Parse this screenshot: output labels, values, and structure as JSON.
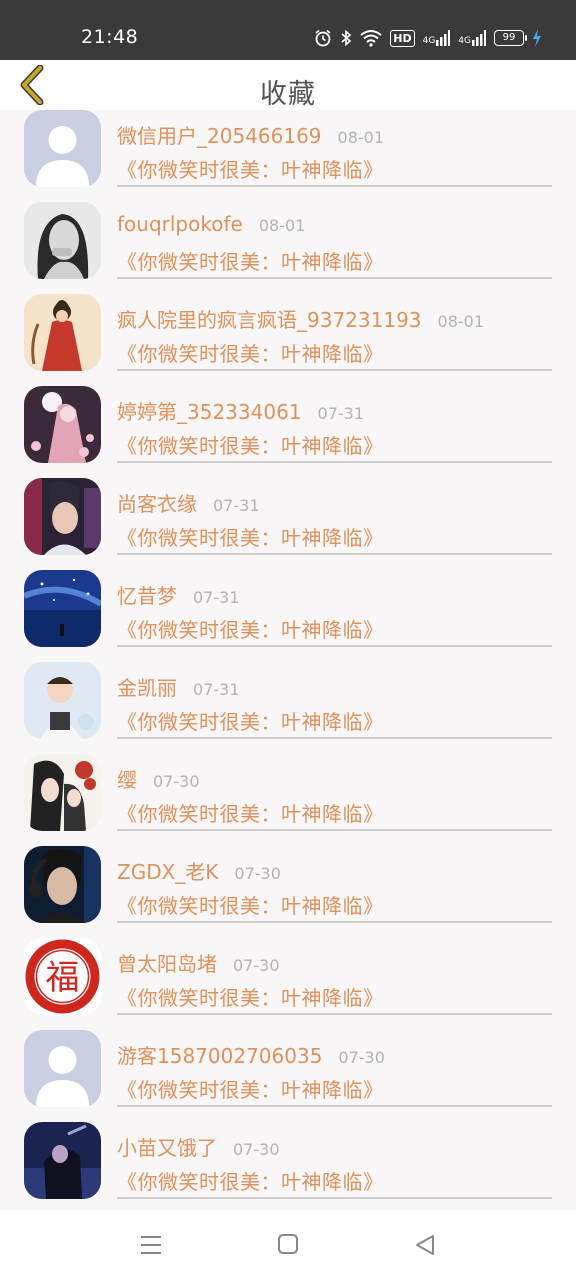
{
  "status_bar": {
    "time": "21:48",
    "hd": "HD",
    "net1": "4G",
    "net2": "4G",
    "battery": "99",
    "colors": {
      "background": "#3a3a3a",
      "charging": "#3fa9f5"
    }
  },
  "header": {
    "title": "收藏",
    "back_icon": "chevron-left-icon",
    "back_color": "#b59317"
  },
  "colors": {
    "accent": "#e0925a",
    "date": "#b3b3b3"
  },
  "items": [
    {
      "name": "微信用户_205466169",
      "date": "08-01",
      "book": "《你微笑时很美：叶神降临》",
      "avatar": "default-avatar"
    },
    {
      "name": "fouqrlpokofe",
      "date": "08-01",
      "book": "《你微笑时很美：叶神降临》",
      "avatar": "photo-avatar"
    },
    {
      "name": "疯人院里的疯言疯语_937231193",
      "date": "08-01",
      "book": "《你微笑时很美：叶神降临》",
      "avatar": "photo-avatar"
    },
    {
      "name": "婷婷第_352334061",
      "date": "07-31",
      "book": "《你微笑时很美：叶神降临》",
      "avatar": "photo-avatar"
    },
    {
      "name": "尚客衣缘",
      "date": "07-31",
      "book": "《你微笑时很美：叶神降临》",
      "avatar": "photo-avatar"
    },
    {
      "name": "忆昔梦",
      "date": "07-31",
      "book": "《你微笑时很美：叶神降临》",
      "avatar": "photo-avatar"
    },
    {
      "name": "金凯丽",
      "date": "07-31",
      "book": "《你微笑时很美：叶神降临》",
      "avatar": "photo-avatar"
    },
    {
      "name": "缨",
      "date": "07-30",
      "book": "《你微笑时很美：叶神降临》",
      "avatar": "photo-avatar"
    },
    {
      "name": "ZGDX_老K",
      "date": "07-30",
      "book": "《你微笑时很美：叶神降临》",
      "avatar": "photo-avatar"
    },
    {
      "name": "曾太阳岛堵",
      "date": "07-30",
      "book": "《你微笑时很美：叶神降临》",
      "avatar": "fu-avatar"
    },
    {
      "name": "游客1587002706035",
      "date": "07-30",
      "book": "《你微笑时很美：叶神降临》",
      "avatar": "default-avatar"
    },
    {
      "name": "小苗又饿了",
      "date": "07-30",
      "book": "《你微笑时很美：叶神降临》",
      "avatar": "photo-avatar"
    }
  ],
  "nav": {
    "menu_icon": "menu-icon",
    "home_icon": "home-square-icon",
    "back_icon": "back-triangle-icon"
  }
}
